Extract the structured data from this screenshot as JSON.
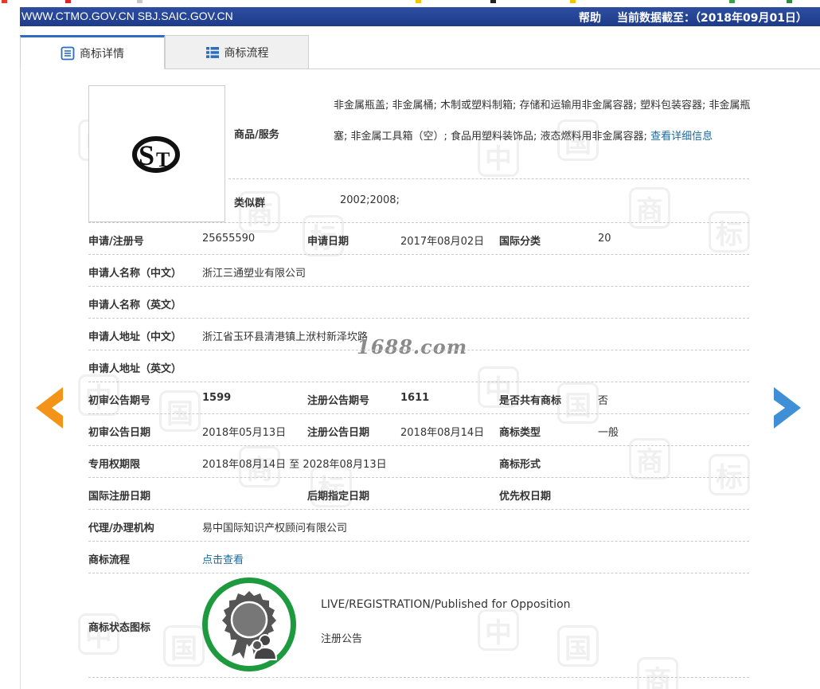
{
  "header": {
    "url": "WWW.CTMO.GOV.CN SBJ.SAIC.GOV.CN",
    "help": "帮助",
    "data_date": "当前数据截至：（2018年09月01日）"
  },
  "tabs": [
    {
      "label": "商标详情",
      "active": true
    },
    {
      "label": "商标流程",
      "active": false
    }
  ],
  "goods": {
    "label": "商品/服务",
    "text": "非金属瓶盖; 非金属桶; 木制或塑料制箱; 存储和运输用非金属容器; 塑料包装容器; 非金属瓶塞; 非金属工具箱（空）; 食品用塑料装饰品; 液态燃料用非金属容器; ",
    "more_link": "查看详细信息"
  },
  "similar_group": {
    "label": "类似群",
    "value": "2002;2008;"
  },
  "fields": {
    "reg_no_label": "申请/注册号",
    "reg_no": "25655590",
    "apply_date_label": "申请日期",
    "apply_date": "2017年08月02日",
    "intl_class_label": "国际分类",
    "intl_class": "20",
    "applicant_cn_label": "申请人名称（中文）",
    "applicant_cn": "浙江三通塑业有限公司",
    "applicant_en_label": "申请人名称（英文）",
    "applicant_en": "",
    "address_cn_label": "申请人地址（中文）",
    "address_cn": "浙江省玉环县清港镇上洑村新泽坎路",
    "address_en_label": "申请人地址（英文）",
    "address_en": "",
    "prelim_issue_label": "初审公告期号",
    "prelim_issue": "1599",
    "reg_issue_label": "注册公告期号",
    "reg_issue": "1611",
    "shared_label": "是否共有商标",
    "shared": "否",
    "prelim_date_label": "初审公告日期",
    "prelim_date": "2018年05月13日",
    "reg_date_label": "注册公告日期",
    "reg_date": "2018年08月14日",
    "tm_type_label": "商标类型",
    "tm_type": "一般",
    "excl_period_label": "专用权期限",
    "excl_period": "2018年08月14日 至 2028年08月13日",
    "tm_form_label": "商标形式",
    "tm_form": "",
    "intl_reg_date_label": "国际注册日期",
    "intl_reg_date": "",
    "later_designation_label": "后期指定日期",
    "later_designation": "",
    "priority_date_label": "优先权日期",
    "priority_date": "",
    "agency_label": "代理/办理机构",
    "agency": "易中国际知识产权顾问有限公司",
    "process_label": "商标流程",
    "process_link": "点击查看",
    "status_icon_label": "商标状态图标",
    "status_en": "LIVE/REGISTRATION/Published for Opposition",
    "status_cn": "注册公告"
  },
  "watermark": {
    "site": "1688.com",
    "chars": [
      "中",
      "国",
      "商",
      "标"
    ]
  },
  "colors": {
    "banner": "#1e3b8a",
    "link": "#1a6aa0",
    "arrow_left": "#f39419",
    "arrow_right": "#3f8fd6",
    "status_ring": "#1d9a3e"
  }
}
